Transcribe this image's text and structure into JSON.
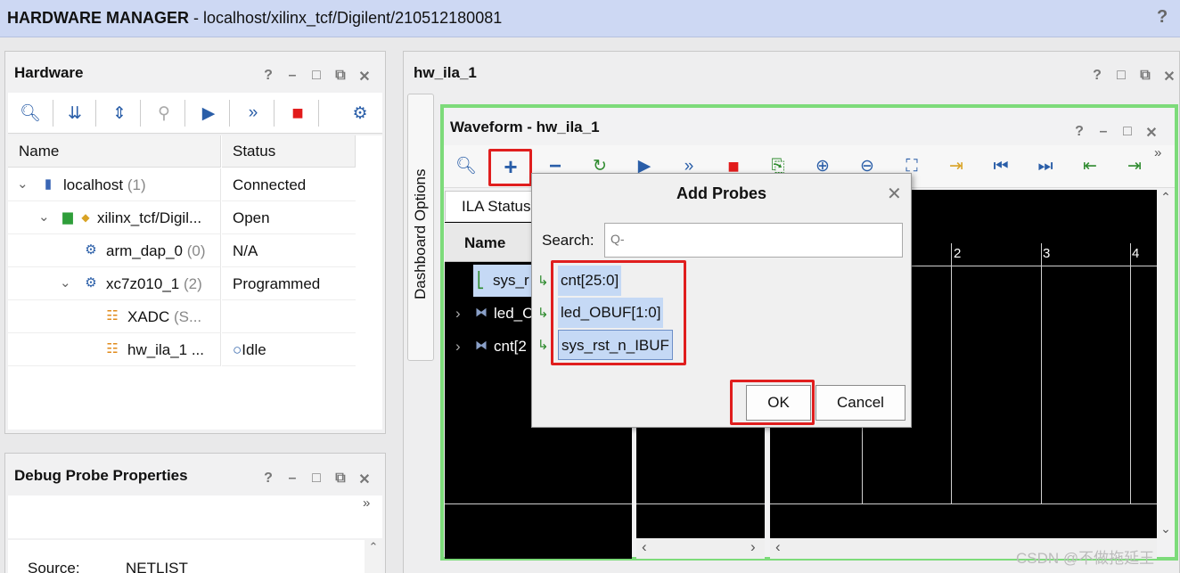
{
  "titlebar": {
    "title_bold": "HARDWARE MANAGER",
    "title_rest": " - localhost/xilinx_tcf/Digilent/210512180081",
    "help": "?"
  },
  "hardware": {
    "title": "Hardware",
    "win_buttons": [
      "?",
      "–",
      "□",
      "⧉",
      "✕"
    ],
    "columns": [
      "Name",
      "Status"
    ],
    "rows": [
      {
        "name": "localhost",
        "count": "(1)",
        "status": "Connected"
      },
      {
        "name": "xilinx_tcf/Digil...",
        "count": "",
        "status": "Open"
      },
      {
        "name": "arm_dap_0",
        "count": "(0)",
        "status": "N/A"
      },
      {
        "name": "xc7z010_1",
        "count": "(2)",
        "status": "Programmed"
      },
      {
        "name": "XADC",
        "count": "(S...",
        "status": ""
      },
      {
        "name": "hw_ila_1 ...",
        "count": "",
        "status": "Idle"
      }
    ]
  },
  "debug_probe": {
    "title": "Debug Probe Properties",
    "more": "»",
    "source_label": "Source:",
    "source_value": "NETLIST"
  },
  "right": {
    "tab_title": "hw_ila_1",
    "dashboard_tab": "Dashboard Options",
    "waveform_title": "Waveform - hw_ila_1",
    "ila_status_tab": "ILA Status",
    "name_header": "Name",
    "wave_rows": [
      "sys_r",
      "led_C",
      "cnt[2"
    ],
    "ticks": [
      "2",
      "3",
      "4"
    ],
    "more": "»"
  },
  "dialog": {
    "title": "Add Probes",
    "search_label": "Search:",
    "search_placeholder": "Q-",
    "probes": [
      "cnt[25:0]",
      "led_OBUF[1:0]",
      "sys_rst_n_IBUF"
    ],
    "ok": "OK",
    "cancel": "Cancel"
  },
  "watermark": "CSDN @不做拖延王",
  "colors": {
    "highlight": "#e01e1e",
    "waveform_border": "#7ddb7a",
    "selection": "#c5d9f5",
    "accent": "#2a5ea8"
  }
}
